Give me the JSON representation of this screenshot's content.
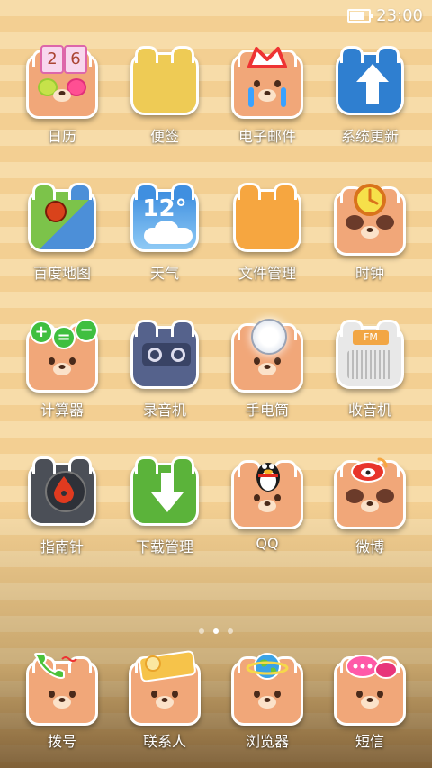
{
  "status_bar": {
    "time": "23:00",
    "battery_icon": "battery-icon"
  },
  "apps": [
    {
      "label": "日历",
      "icon": "calendar-icon",
      "date_left": "2",
      "date_right": "6"
    },
    {
      "label": "便签",
      "icon": "notes-icon"
    },
    {
      "label": "电子邮件",
      "icon": "email-icon"
    },
    {
      "label": "系统更新",
      "icon": "system-update-icon"
    },
    {
      "label": "百度地图",
      "icon": "baidu-map-icon"
    },
    {
      "label": "天气",
      "icon": "weather-icon",
      "temperature": "12°"
    },
    {
      "label": "文件管理",
      "icon": "folder-icon"
    },
    {
      "label": "时钟",
      "icon": "clock-icon"
    },
    {
      "label": "计算器",
      "icon": "calculator-icon"
    },
    {
      "label": "录音机",
      "icon": "recorder-icon"
    },
    {
      "label": "手电筒",
      "icon": "flashlight-icon"
    },
    {
      "label": "收音机",
      "icon": "radio-icon",
      "radio_text": "FM"
    },
    {
      "label": "指南针",
      "icon": "compass-icon"
    },
    {
      "label": "下载管理",
      "icon": "download-icon"
    },
    {
      "label": "QQ",
      "icon": "qq-icon"
    },
    {
      "label": "微博",
      "icon": "weibo-icon"
    }
  ],
  "page_indicator": {
    "count": 3,
    "active": 2
  },
  "dock": [
    {
      "label": "拨号",
      "icon": "phone-icon"
    },
    {
      "label": "联系人",
      "icon": "contacts-icon"
    },
    {
      "label": "浏览器",
      "icon": "browser-icon"
    },
    {
      "label": "短信",
      "icon": "messages-icon"
    }
  ]
}
